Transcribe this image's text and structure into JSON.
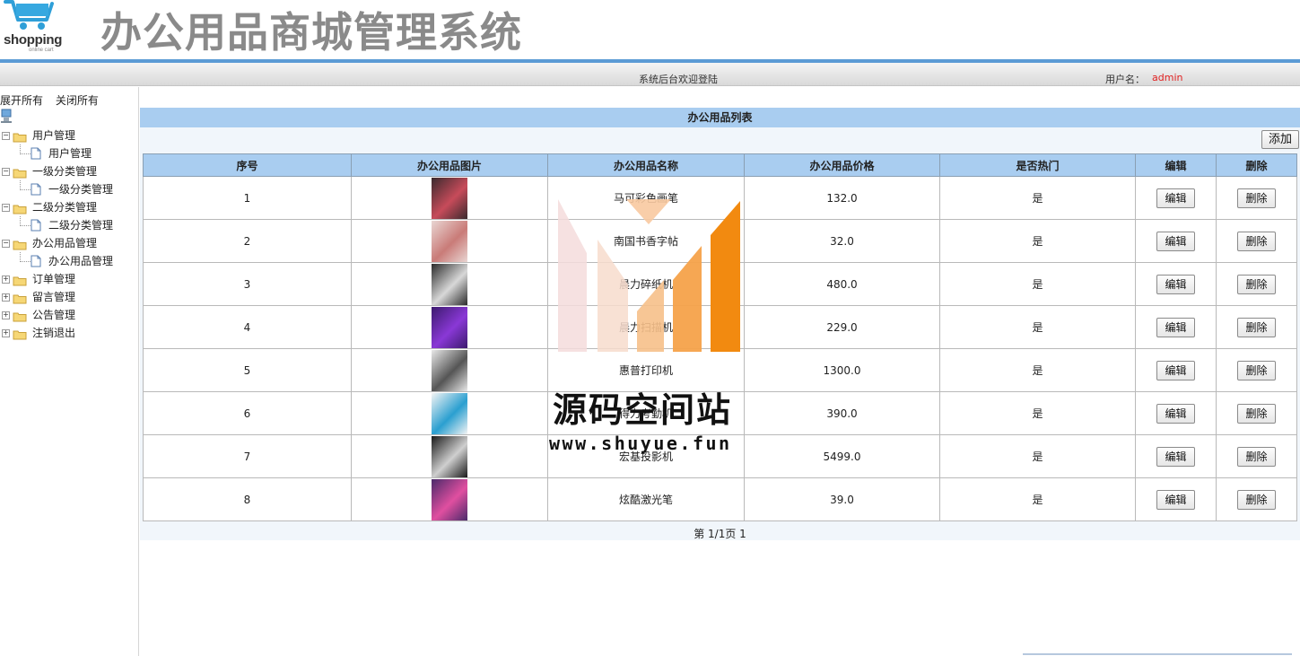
{
  "header": {
    "logo_text": "shopping",
    "logo_sub": "online cart",
    "title": "办公用品商城管理系统"
  },
  "welcome": {
    "text": "系统后台欢迎登陆",
    "user_label": "用户名：",
    "user_name": "admin"
  },
  "sidebar": {
    "expand_all": "展开所有",
    "collapse_all": "关闭所有",
    "groups": [
      {
        "label": "用户管理",
        "children": [
          "用户管理"
        ]
      },
      {
        "label": "一级分类管理",
        "children": [
          "一级分类管理"
        ]
      },
      {
        "label": "二级分类管理",
        "children": [
          "二级分类管理"
        ]
      },
      {
        "label": "办公用品管理",
        "children": [
          "办公用品管理"
        ]
      },
      {
        "label": "订单管理",
        "children": []
      },
      {
        "label": "留言管理",
        "children": []
      },
      {
        "label": "公告管理",
        "children": []
      },
      {
        "label": "注销退出",
        "children": []
      }
    ]
  },
  "main": {
    "panel_title": "办公用品列表",
    "add_label": "添加",
    "columns": [
      "序号",
      "办公用品图片",
      "办公用品名称",
      "办公用品价格",
      "是否热门",
      "编辑",
      "删除"
    ],
    "edit_label": "编辑",
    "delete_label": "删除",
    "rows": [
      {
        "no": "1",
        "name": "马可彩色画笔",
        "price": "132.0",
        "hot": "是",
        "thumb": [
          "#3a2a2e",
          "#c74b5a"
        ]
      },
      {
        "no": "2",
        "name": "南国书香字帖",
        "price": "32.0",
        "hot": "是",
        "thumb": [
          "#e9d6d3",
          "#c97b78"
        ]
      },
      {
        "no": "3",
        "name": "晨力碎纸机",
        "price": "480.0",
        "hot": "是",
        "thumb": [
          "#2b2b2b",
          "#d8d8d8"
        ]
      },
      {
        "no": "4",
        "name": "晨力扫描机",
        "price": "229.0",
        "hot": "是",
        "thumb": [
          "#3c1a6e",
          "#8a38d6"
        ]
      },
      {
        "no": "5",
        "name": "惠普打印机",
        "price": "1300.0",
        "hot": "是",
        "thumb": [
          "#e8e8e8",
          "#555555"
        ]
      },
      {
        "no": "6",
        "name": "得力考勤机",
        "price": "390.0",
        "hot": "是",
        "thumb": [
          "#f4f4f4",
          "#2a9fd0"
        ]
      },
      {
        "no": "7",
        "name": "宏基投影机",
        "price": "5499.0",
        "hot": "是",
        "thumb": [
          "#1a1a1a",
          "#cfcfcf"
        ]
      },
      {
        "no": "8",
        "name": "炫酷激光笔",
        "price": "39.0",
        "hot": "是",
        "thumb": [
          "#4a2a6a",
          "#e04fa0"
        ]
      }
    ],
    "pager": "第 1/1页 1"
  },
  "watermark": {
    "text": "源码空间站",
    "url": "www.shuyue.fun"
  },
  "colors": {
    "accent_bar": "#5b9bd5",
    "table_header": "#a9cdf0",
    "user_name": "#e02020"
  }
}
